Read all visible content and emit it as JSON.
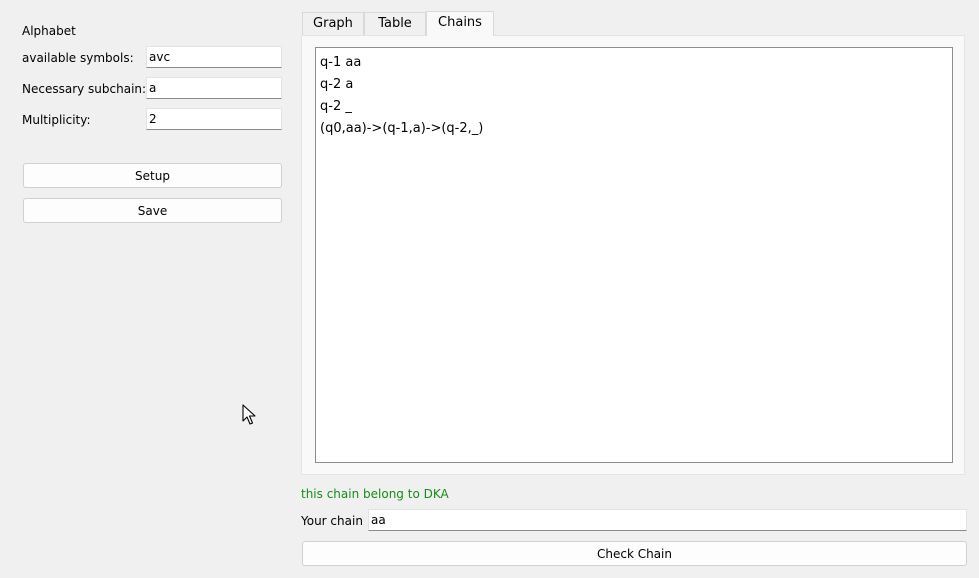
{
  "left_panel": {
    "group_title": "Alphabet",
    "symbols_label": "available symbols:",
    "symbols_value": "avc",
    "subchain_label": "Necessary subchain:",
    "subchain_value": "a",
    "multiplicity_label": "Multiplicity:",
    "multiplicity_value": "2",
    "setup_label": "Setup",
    "save_label": "Save"
  },
  "tabs": [
    {
      "label": "Graph",
      "active": false
    },
    {
      "label": "Table",
      "active": false
    },
    {
      "label": "Chains",
      "active": true
    }
  ],
  "chains_text": {
    "lines": [
      "q-1 aa",
      "q-2 a",
      "q-2 _",
      "(q0,aa)->(q-1,a)->(q-2,_)"
    ]
  },
  "result": {
    "status_text": "this chain belong to DKA",
    "status_color": "#1a8a1a"
  },
  "chain_input": {
    "label": "Your chain",
    "value": "aa"
  },
  "check_button": {
    "label": "Check Chain"
  }
}
